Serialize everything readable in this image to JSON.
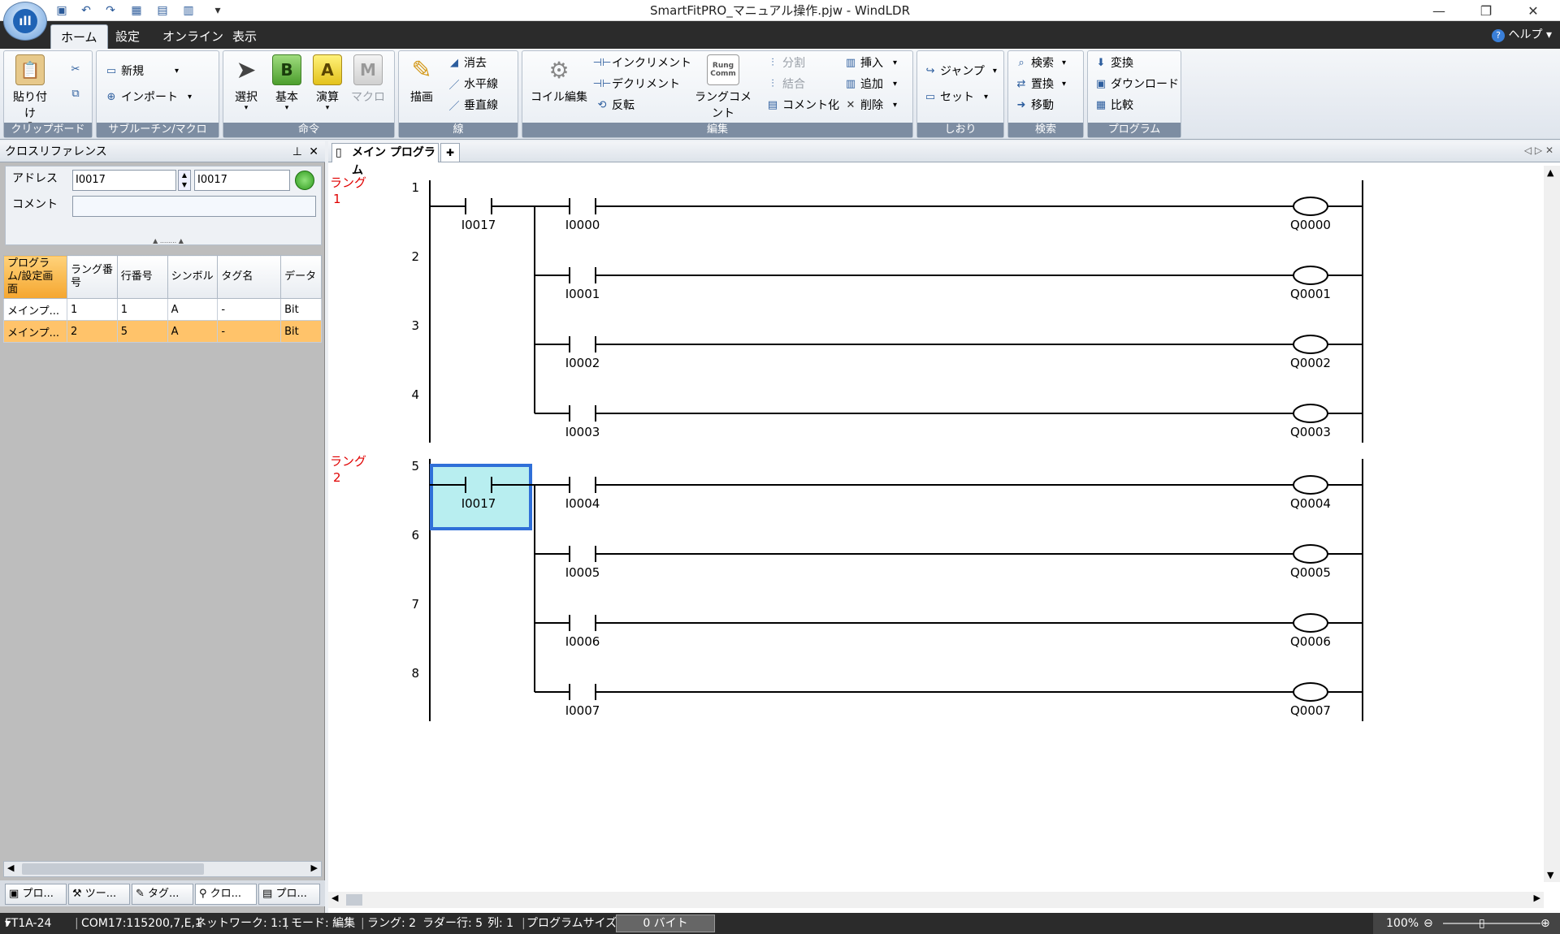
{
  "title_bar": {
    "title": "SmartFitPRO_マニュアル操作.pjw - WindLDR"
  },
  "tabs": [
    {
      "label": "ホーム",
      "active": true
    },
    {
      "label": "設定"
    },
    {
      "label": "オンライン"
    },
    {
      "label": "表示"
    }
  ],
  "help_label": "ヘルプ",
  "ribbon": {
    "clipboard": {
      "name": "クリップボード",
      "paste": "貼り付け"
    },
    "subroutine": {
      "name": "サブルーチン/マクロ",
      "new": "新規",
      "import": "インポート"
    },
    "instruction": {
      "name": "命令",
      "select": "選択",
      "basic": "基本",
      "basic_icon": "B",
      "apply": "演算",
      "apply_icon": "A",
      "macro": "マクロ",
      "macro_icon": "M"
    },
    "line": {
      "name": "線",
      "draw": "描画",
      "erase": "消去",
      "hline": "水平線",
      "vline": "垂直線"
    },
    "edit": {
      "name": "編集",
      "coil_edit": "コイル編集",
      "increment": "インクリメント",
      "decrement": "デクリメント",
      "invert": "反転",
      "rung_comment": "ラングコメント",
      "split": "分割",
      "join": "結合",
      "commentize": "コメント化",
      "insert": "挿入",
      "add": "追加",
      "delete": "削除"
    },
    "bookmark": {
      "name": "しおり",
      "jump": "ジャンプ",
      "set": "セット"
    },
    "search": {
      "name": "検索",
      "search": "検索",
      "replace": "置換",
      "move": "移動"
    },
    "program": {
      "name": "プログラム",
      "convert": "変換",
      "download": "ダウンロード",
      "compare": "比較"
    }
  },
  "left_panel": {
    "title": "クロスリファレンス",
    "address_label": "アドレス",
    "address_from": "I0017",
    "address_to": "I0017",
    "comment_label": "コメント",
    "comment_value": "",
    "columns": [
      "プログラム/設定画面",
      "ラング番号",
      "行番号",
      "シンボル",
      "タグ名",
      "データ"
    ],
    "rows": [
      {
        "program": "メインプ...",
        "rung": "1",
        "line": "1",
        "symbol": "A",
        "tag": "-",
        "data": "Bit",
        "selected": false
      },
      {
        "program": "メインプ...",
        "rung": "2",
        "line": "5",
        "symbol": "A",
        "tag": "-",
        "data": "Bit",
        "selected": true
      }
    ],
    "bottom_tabs": [
      "プロ...",
      "ツー...",
      "タグ...",
      "クロ...",
      "プロ..."
    ]
  },
  "editor": {
    "tab_label": "メイン プログラム",
    "rung_label": "ラング",
    "rungs": [
      {
        "number": "1",
        "trigger": "I0017",
        "lines": [
          {
            "line": "1",
            "input": "I0000",
            "output": "Q0000"
          },
          {
            "line": "2",
            "input": "I0001",
            "output": "Q0001"
          },
          {
            "line": "3",
            "input": "I0002",
            "output": "Q0002"
          },
          {
            "line": "4",
            "input": "I0003",
            "output": "Q0003"
          }
        ]
      },
      {
        "number": "2",
        "trigger": "I0017",
        "selected_cell": true,
        "lines": [
          {
            "line": "5",
            "input": "I0004",
            "output": "Q0004"
          },
          {
            "line": "6",
            "input": "I0005",
            "output": "Q0005"
          },
          {
            "line": "7",
            "input": "I0006",
            "output": "Q0006"
          },
          {
            "line": "8",
            "input": "I0007",
            "output": "Q0007"
          }
        ]
      }
    ]
  },
  "status_bar": {
    "plc": "FT1A-24",
    "port": "COM17:115200,7,E,1",
    "network": "ネットワーク: 1:1",
    "mode": "モード: 編集",
    "rung": "ラング: 2",
    "ladder_row": "ラダー行: 5",
    "column": "列: 1",
    "program_size_label": "プログラムサイズ:",
    "program_size": "0 バイト",
    "zoom": "100%"
  },
  "colors": {
    "accent": "#f5a62f",
    "selection": "#2f6fd8",
    "selection_fill": "#b8eef0",
    "rung_label": "#e00000"
  }
}
